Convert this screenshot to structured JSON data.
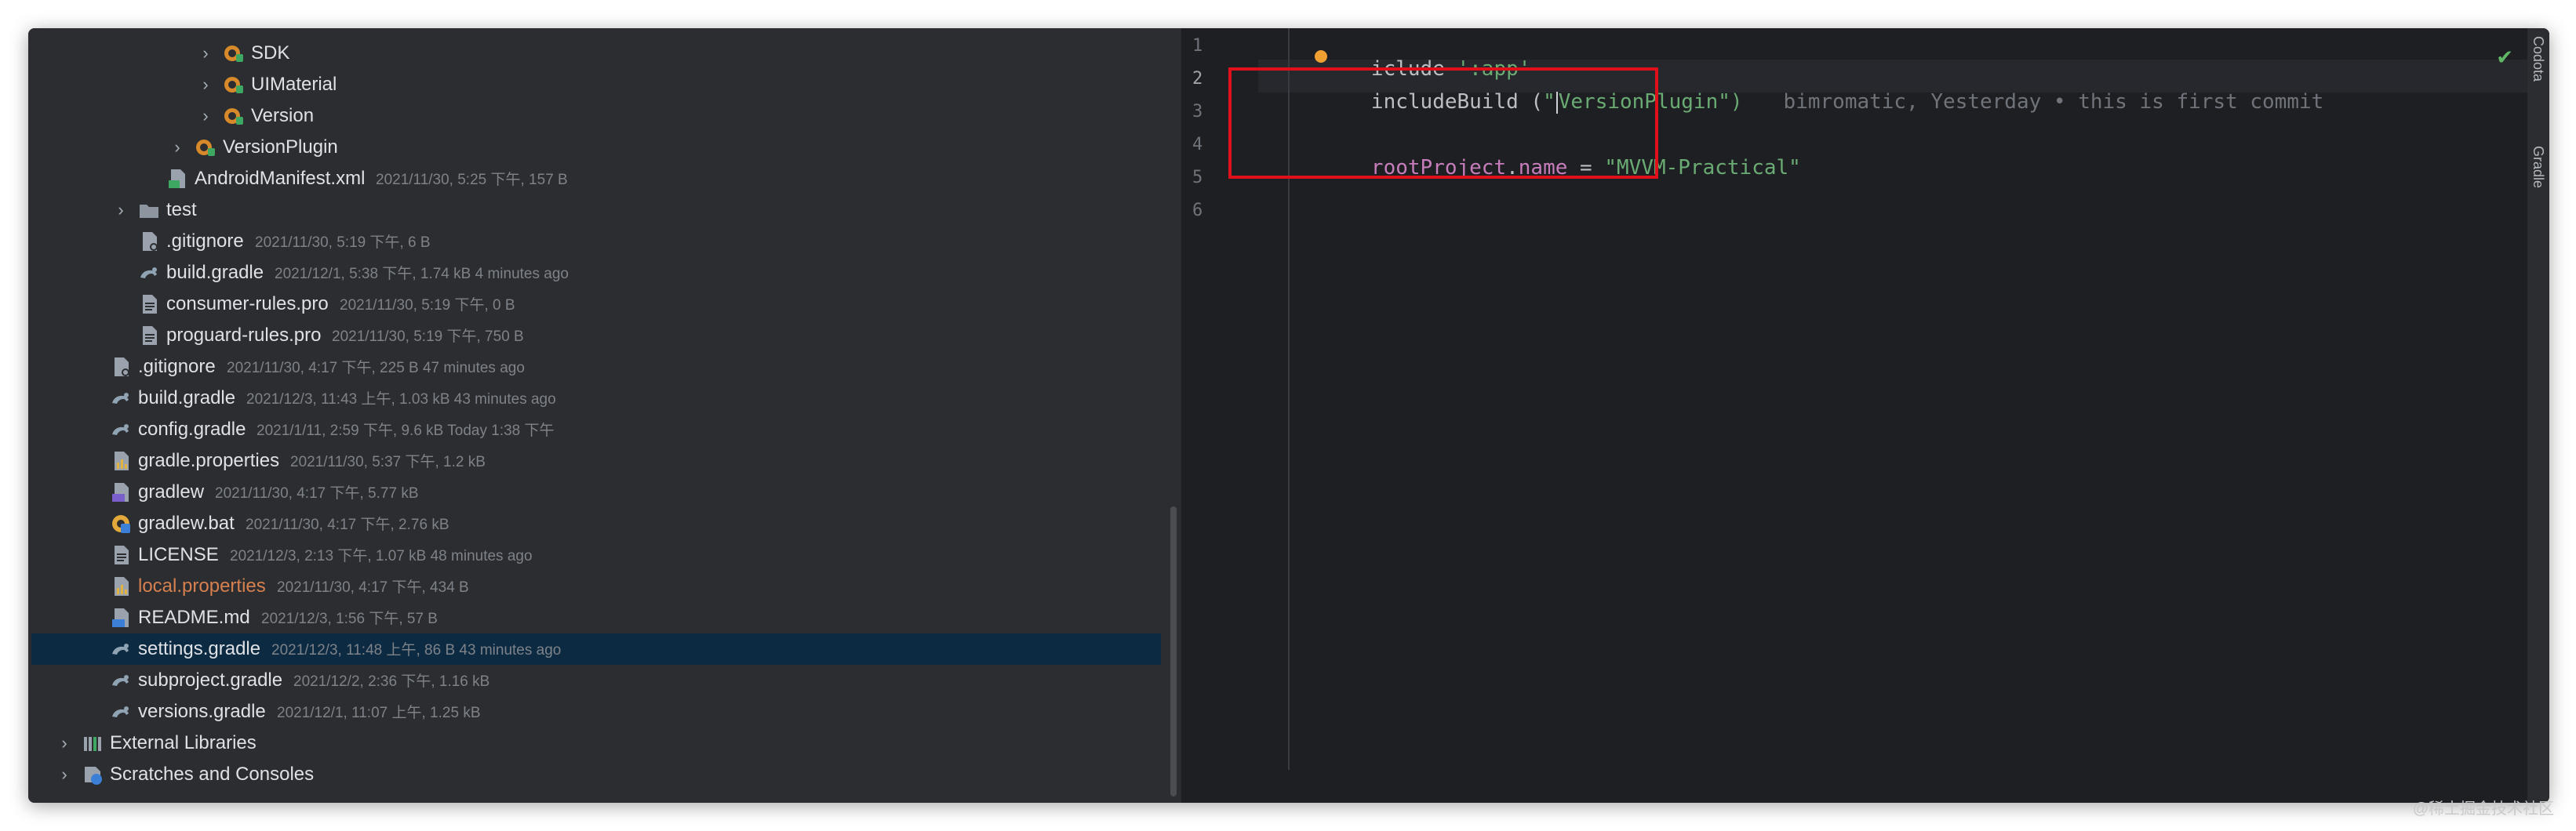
{
  "colors": {
    "accent": "#3574f0",
    "selection": "#0c2a42",
    "modified_text": "#d7804f",
    "highlight_box": "#e0101a"
  },
  "project_tree": [
    {
      "name": "SDK",
      "meta": "",
      "indent": 5,
      "icon": "module-icon",
      "chevron": "closed",
      "modified": false
    },
    {
      "name": "UIMaterial",
      "meta": "",
      "indent": 5,
      "icon": "module-icon",
      "chevron": "closed",
      "modified": false
    },
    {
      "name": "Version",
      "meta": "",
      "indent": 5,
      "icon": "module-icon",
      "chevron": "closed",
      "modified": false
    },
    {
      "name": "VersionPlugin",
      "meta": "",
      "indent": 4,
      "icon": "module-icon",
      "chevron": "closed",
      "modified": false
    },
    {
      "name": "AndroidManifest.xml",
      "meta": "2021/11/30, 5:25 下午, 157 B",
      "indent": 3,
      "icon": "manifest-file-icon",
      "chevron": "",
      "modified": false
    },
    {
      "name": "test",
      "meta": "",
      "indent": 2,
      "icon": "folder-icon",
      "chevron": "closed",
      "modified": false
    },
    {
      "name": ".gitignore",
      "meta": "2021/11/30, 5:19 下午, 6 B",
      "indent": 2,
      "icon": "gitignore-file-icon",
      "chevron": "",
      "modified": false
    },
    {
      "name": "build.gradle",
      "meta": "2021/12/1, 5:38 下午, 1.74 kB 4 minutes ago",
      "indent": 2,
      "icon": "gradle-file-icon",
      "chevron": "",
      "modified": false
    },
    {
      "name": "consumer-rules.pro",
      "meta": "2021/11/30, 5:19 下午, 0 B",
      "indent": 2,
      "icon": "text-file-icon",
      "chevron": "",
      "modified": false
    },
    {
      "name": "proguard-rules.pro",
      "meta": "2021/11/30, 5:19 下午, 750 B",
      "indent": 2,
      "icon": "text-file-icon",
      "chevron": "",
      "modified": false
    },
    {
      "name": ".gitignore",
      "meta": "2021/11/30, 4:17 下午, 225 B 47 minutes ago",
      "indent": 1,
      "icon": "gitignore-file-icon",
      "chevron": "",
      "modified": false
    },
    {
      "name": "build.gradle",
      "meta": "2021/12/3, 11:43 上午, 1.03 kB 43 minutes ago",
      "indent": 1,
      "icon": "gradle-file-icon",
      "chevron": "",
      "modified": false
    },
    {
      "name": "config.gradle",
      "meta": "2021/1/11, 2:59 下午, 9.6 kB Today 1:38 下午",
      "indent": 1,
      "icon": "gradle-file-icon",
      "chevron": "",
      "modified": false
    },
    {
      "name": "gradle.properties",
      "meta": "2021/11/30, 5:37 下午, 1.2 kB",
      "indent": 1,
      "icon": "properties-file-icon",
      "chevron": "",
      "modified": false
    },
    {
      "name": "gradlew",
      "meta": "2021/11/30, 4:17 下午, 5.77 kB",
      "indent": 1,
      "icon": "shell-file-icon",
      "chevron": "",
      "modified": false
    },
    {
      "name": "gradlew.bat",
      "meta": "2021/11/30, 4:17 下午, 2.76 kB",
      "indent": 1,
      "icon": "bat-file-icon",
      "chevron": "",
      "modified": false
    },
    {
      "name": "LICENSE",
      "meta": "2021/12/3, 2:13 下午, 1.07 kB 48 minutes ago",
      "indent": 1,
      "icon": "text-file-icon",
      "chevron": "",
      "modified": false
    },
    {
      "name": "local.properties",
      "meta": "2021/11/30, 4:17 下午, 434 B",
      "indent": 1,
      "icon": "properties-file-icon",
      "chevron": "",
      "modified": true
    },
    {
      "name": "README.md",
      "meta": "2021/12/3, 1:56 下午, 57 B",
      "indent": 1,
      "icon": "markdown-file-icon",
      "chevron": "",
      "modified": false
    },
    {
      "name": "settings.gradle",
      "meta": "2021/12/3, 11:48 上午, 86 B 43 minutes ago",
      "indent": 1,
      "icon": "gradle-file-icon",
      "chevron": "",
      "modified": false,
      "selected": true
    },
    {
      "name": "subproject.gradle",
      "meta": "2021/12/2, 2:36 下午, 1.16 kB",
      "indent": 1,
      "icon": "gradle-file-icon",
      "chevron": "",
      "modified": false
    },
    {
      "name": "versions.gradle",
      "meta": "2021/12/1, 11:07 上午, 1.25 kB",
      "indent": 1,
      "icon": "gradle-file-icon",
      "chevron": "",
      "modified": false
    },
    {
      "name": "External Libraries",
      "meta": "",
      "indent": 0,
      "icon": "libraries-icon",
      "chevron": "closed",
      "modified": false
    },
    {
      "name": "Scratches and Consoles",
      "meta": "",
      "indent": 0,
      "icon": "scratches-icon",
      "chevron": "closed",
      "modified": false
    }
  ],
  "editor": {
    "line_numbers": [
      "1",
      "2",
      "3",
      "4",
      "5",
      "6"
    ],
    "line1": {
      "a": "i",
      "b": "clude ",
      "str": "':app'"
    },
    "line2": {
      "kw": "includeBuild (",
      "q1": "\"",
      "str": "VersionPlugin",
      "q2": "\")",
      "blame": "bimromatic, Yesterday • this is first commit"
    },
    "line5": {
      "p1": "rootProject",
      "dot": ".",
      "p2": "name",
      "eq": " = ",
      "str": "\"MVVM-Practical\""
    }
  },
  "side_tabs": [
    "Codota",
    "Gradle"
  ],
  "watermark": "@稀土掘金技术社区"
}
